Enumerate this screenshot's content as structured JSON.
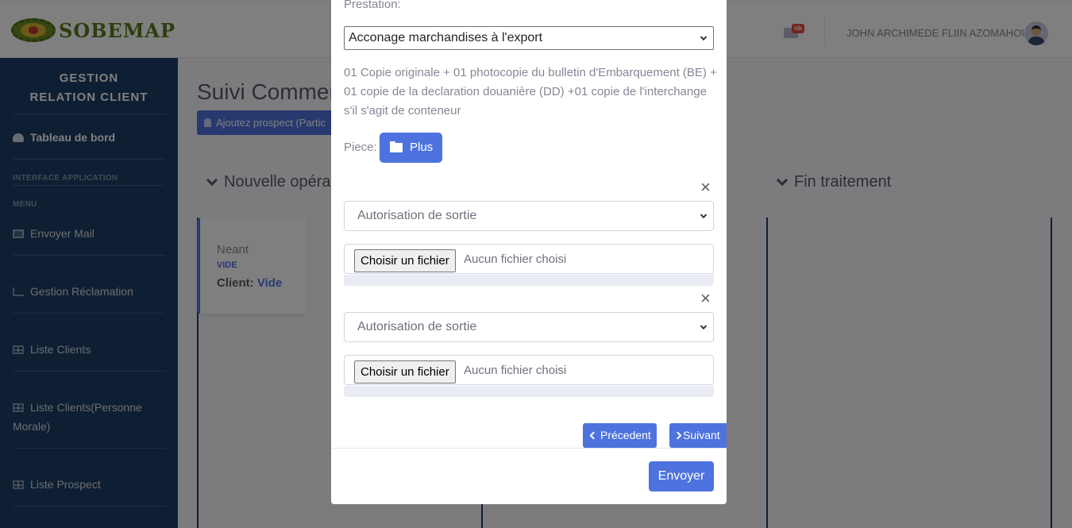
{
  "brand": {
    "logo_text": "SOBEMAP"
  },
  "topbar": {
    "badge": "nb",
    "user_name": "JOHN ARCHIMEDE FLIIN AZOMAHOU"
  },
  "sidebar": {
    "title_line1": "GESTION",
    "title_line2": "RELATION CLIENT",
    "dashboard": "Tableau de bord",
    "heading_interface": "INTERFACE APPLICATION",
    "heading_menu": "MENU",
    "items": [
      {
        "label": "Envoyer Mail",
        "icon": "envelope-icon"
      },
      {
        "label": "Gestion Réclamation",
        "icon": "chart-icon"
      },
      {
        "label": "Liste Clients",
        "icon": "table-icon"
      },
      {
        "label": "Liste Clients(Personne Morale)",
        "icon": "table-icon"
      },
      {
        "label": "Liste Prospect",
        "icon": "table-icon"
      }
    ]
  },
  "main": {
    "title": "Suivi Commer",
    "prospect_button": "Ajoutez prospect (Partic",
    "columns": [
      "Nouvelle opéra",
      "Fin traitement"
    ],
    "card": {
      "title": "Neant",
      "subtitle": "VIDE",
      "client_label": "Client:",
      "client_value": "Vide"
    }
  },
  "modal": {
    "prestation_label": "Prestation:",
    "prestation_value": "Acconage marchandises à l'export",
    "description": "01 Copie originale + 01 photocopie du bulletin d'Embarquement (BE) + 01 copie de la declaration douanière (DD) +01 copie de l'interchange s'il s'agit de conteneur",
    "piece_label": "Piece:",
    "plus_button": "Plus",
    "documents": [
      {
        "type": "Autorisation de sortie",
        "file_button": "Choisir un fichier",
        "file_status": "Aucun fichier choisi"
      },
      {
        "type": "Autorisation de sortie",
        "file_button": "Choisir un fichier",
        "file_status": "Aucun fichier choisi"
      }
    ],
    "prev_button": "Précedent",
    "next_button": "Suivant",
    "send_button": "Envoyer"
  },
  "colors": {
    "primary": "#4e73df",
    "sidebar": "#1e3f66",
    "overlay": "rgba(0,0,0,0.5)"
  }
}
